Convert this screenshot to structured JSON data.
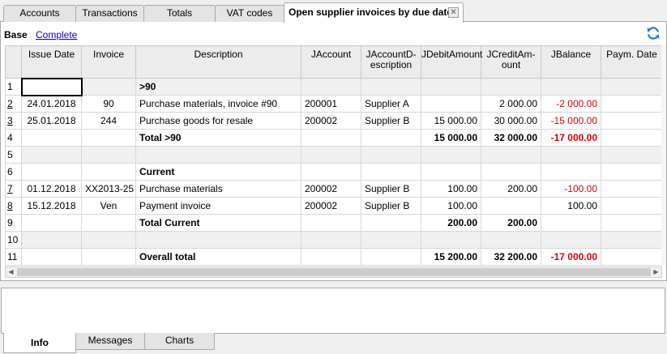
{
  "top_tabs": [
    {
      "label": "Accounts"
    },
    {
      "label": "Transactions"
    },
    {
      "label": "Totals"
    },
    {
      "label": "VAT codes"
    },
    {
      "label": "Open supplier invoices by due date"
    }
  ],
  "close_glyph": "✕",
  "views": {
    "base": "Base",
    "complete": "Complete"
  },
  "icons": {
    "refresh": "refresh-icon",
    "close": "close-icon"
  },
  "columns": [
    "Issue Date",
    "Invoice",
    "Description",
    "JAccount",
    "JAccountD-\nescription",
    "JDebitAmount",
    "JCreditAm-\nount",
    "JBalance",
    "Paym. Date"
  ],
  "rows": [
    {
      "num": "1",
      "date": "",
      "invoice": "",
      "desc": ">90",
      "account": "",
      "account_desc": "",
      "debit": "",
      "credit": "",
      "balance": ""
    },
    {
      "num": "2",
      "date": "24.01.2018",
      "invoice": "90",
      "desc": "Purchase materials, invoice #90",
      "account": "200001",
      "account_desc": "Supplier A",
      "debit": "",
      "credit": "2 000.00",
      "balance": "-2 000.00"
    },
    {
      "num": "3",
      "date": "25.01.2018",
      "invoice": "244",
      "desc": "Purchase goods for resale",
      "account": "200002",
      "account_desc": "Supplier B",
      "debit": "15 000.00",
      "credit": "30 000.00",
      "balance": "-15 000.00"
    },
    {
      "num": "4",
      "date": "",
      "invoice": "",
      "desc": "Total >90",
      "account": "",
      "account_desc": "",
      "debit": "15 000.00",
      "credit": "32 000.00",
      "balance": "-17 000.00"
    },
    {
      "num": "5",
      "date": "",
      "invoice": "",
      "desc": "",
      "account": "",
      "account_desc": "",
      "debit": "",
      "credit": "",
      "balance": ""
    },
    {
      "num": "6",
      "date": "",
      "invoice": "",
      "desc": "Current",
      "account": "",
      "account_desc": "",
      "debit": "",
      "credit": "",
      "balance": ""
    },
    {
      "num": "7",
      "date": "01.12.2018",
      "invoice": "XX2013-25",
      "desc": "Purchase materials",
      "account": "200002",
      "account_desc": "Supplier B",
      "debit": "100.00",
      "credit": "200.00",
      "balance": "-100.00"
    },
    {
      "num": "8",
      "date": "15.12.2018",
      "invoice": "Ven",
      "desc": "Payment invoice",
      "account": "200002",
      "account_desc": "Supplier B",
      "debit": "100.00",
      "credit": "",
      "balance": "100.00"
    },
    {
      "num": "9",
      "date": "",
      "invoice": "",
      "desc": "Total Current",
      "account": "",
      "account_desc": "",
      "debit": "200.00",
      "credit": "200.00",
      "balance": ""
    },
    {
      "num": "10",
      "date": "",
      "invoice": "",
      "desc": "",
      "account": "",
      "account_desc": "",
      "debit": "",
      "credit": "",
      "balance": ""
    },
    {
      "num": "11",
      "date": "",
      "invoice": "",
      "desc": "Overall total",
      "account": "",
      "account_desc": "",
      "debit": "15 200.00",
      "credit": "32 200.00",
      "balance": "-17 000.00"
    }
  ],
  "bottom_tabs": [
    {
      "label": "Info"
    },
    {
      "label": "Messages"
    },
    {
      "label": "Charts"
    }
  ],
  "colors": {
    "negative": "#e00000",
    "link": "#0000d0",
    "refresh": "#1e7fd0"
  }
}
